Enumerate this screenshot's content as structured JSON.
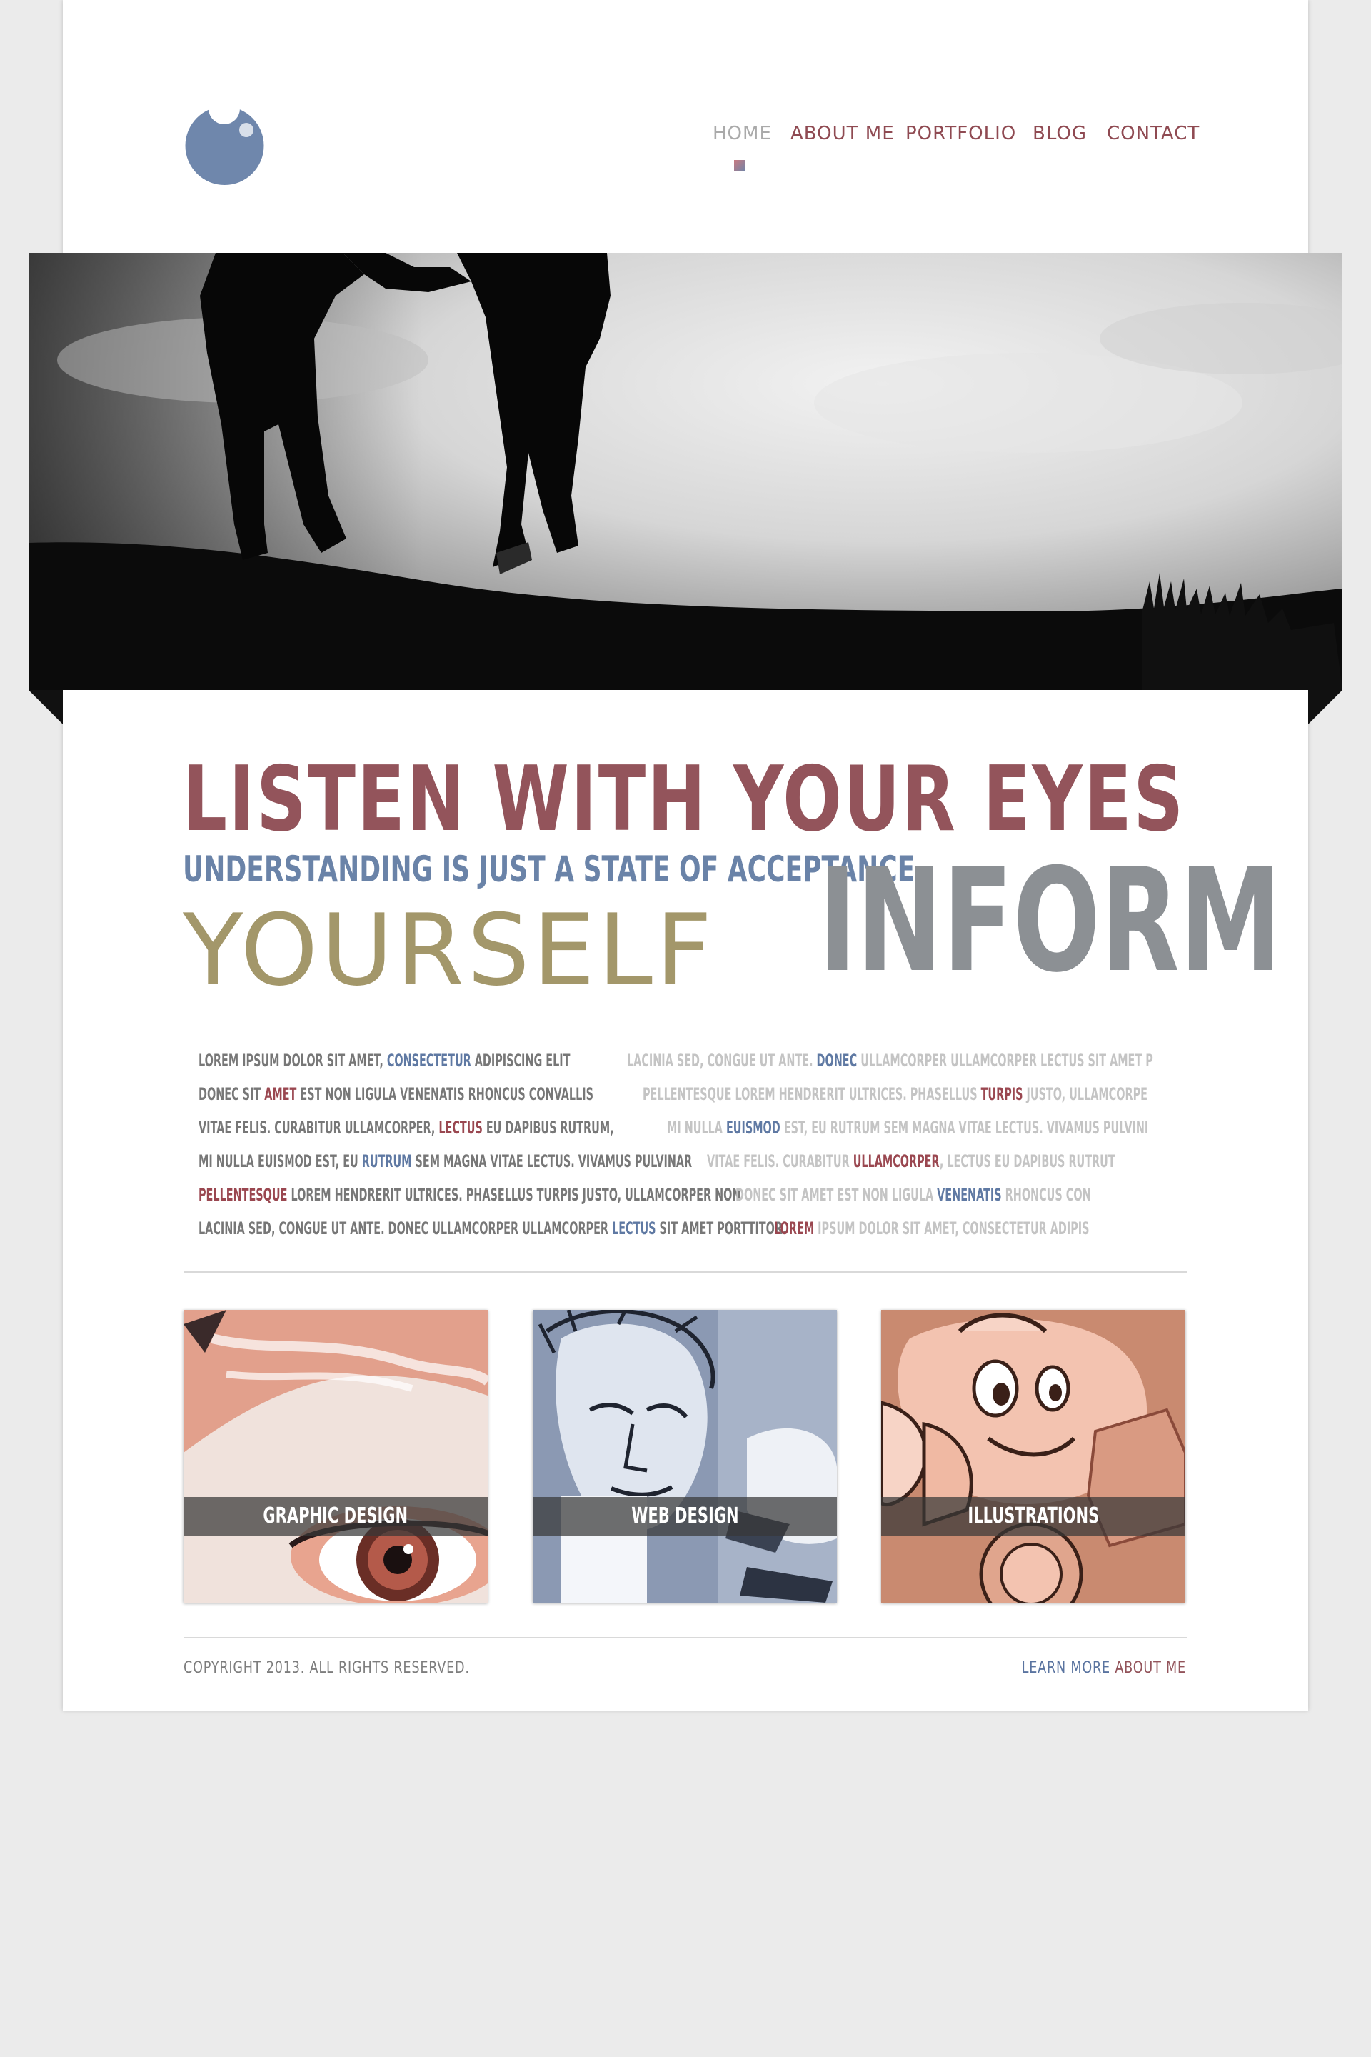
{
  "colors": {
    "background": "#ebebeb",
    "page": "#ffffff",
    "accent_red": "#93545b",
    "accent_blue": "#6a83a8",
    "accent_olive": "#a3976a",
    "accent_grey": "#8c9094"
  },
  "header": {
    "logo_icon": "circle-logo",
    "nav": [
      {
        "label": "HOME",
        "active": true
      },
      {
        "label": "ABOUT ME",
        "active": false
      },
      {
        "label": "PORTFOLIO",
        "active": false
      },
      {
        "label": "BLOG",
        "active": false
      },
      {
        "label": "CONTACT",
        "active": false
      }
    ]
  },
  "hero": {
    "image": "silhouette-couple-on-hill"
  },
  "headline": {
    "line1": "LISTEN WITH YOUR EYES",
    "line2": "UNDERSTANDING IS JUST A STATE OF ACCEPTANCE",
    "line3": "YOURSELF",
    "line4": "INFORM"
  },
  "lorem": {
    "left": [
      [
        "LOREM IPSUM DOLOR SIT AMET, ",
        {
          "t": "CONSECTETUR",
          "c": "blue"
        },
        " ADIPISCING ELIT"
      ],
      [
        "DONEC SIT ",
        {
          "t": "AMET",
          "c": "red"
        },
        " EST NON LIGULA VENENATIS RHONCUS CONVALLIS"
      ],
      [
        "VITAE FELIS. CURABITUR ULLAMCORPER, ",
        {
          "t": "LECTUS",
          "c": "red"
        },
        " EU DAPIBUS RUTRUM,"
      ],
      [
        "MI NULLA EUISMOD EST, EU ",
        {
          "t": "RUTRUM",
          "c": "blue"
        },
        " SEM MAGNA VITAE LECTUS. VIVAMUS PULVINAR"
      ],
      [
        {
          "t": "PELLENTESQUE",
          "c": "red"
        },
        " LOREM HENDRERIT ULTRICES. PHASELLUS TURPIS JUSTO, ULLAMCORPER NON"
      ],
      [
        "LACINIA SED, CONGUE UT ANTE. DONEC ULLAMCORPER ULLAMCORPER ",
        {
          "t": "LECTUS",
          "c": "blue"
        },
        " SIT AMET PORTTITOR."
      ]
    ],
    "right": [
      [
        "LACINIA SED, CONGUE UT ANTE. ",
        {
          "t": "DONEC",
          "c": "blue"
        },
        " ULLAMCORPER ULLAMCORPER LECTUS SIT AMET P"
      ],
      [
        "PELLENTESQUE LOREM HENDRERIT ULTRICES. PHASELLUS ",
        {
          "t": "TURPIS",
          "c": "red"
        },
        " JUSTO, ULLAMCORPE"
      ],
      [
        "MI NULLA ",
        {
          "t": "EUISMOD",
          "c": "blue"
        },
        " EST, EU RUTRUM SEM MAGNA VITAE LECTUS. VIVAMUS PULVINI"
      ],
      [
        "VITAE FELIS. CURABITUR ",
        {
          "t": "ULLAMCORPER",
          "c": "red"
        },
        ", LECTUS EU DAPIBUS RUTRUT"
      ],
      [
        "DONEC SIT AMET EST NON LIGULA ",
        {
          "t": "VENENATIS",
          "c": "blue"
        },
        " RHONCUS CON"
      ],
      [
        {
          "t": "LOREM",
          "c": "red"
        },
        " IPSUM DOLOR SIT AMET, CONSECTETUR ADIPIS"
      ]
    ]
  },
  "cards": [
    {
      "label": "GRAPHIC DESIGN",
      "image": "eye-closeup-illustration"
    },
    {
      "label": "WEB DESIGN",
      "image": "sketch-face-illustration"
    },
    {
      "label": "ILLUSTRATIONS",
      "image": "cartoon-character-illustration"
    }
  ],
  "footer": {
    "copyright": "COPYRIGHT 2013. ALL RIGHTS RESERVED.",
    "learn_more_a": "LEARN MORE",
    "learn_more_b": " ABOUT ME"
  }
}
